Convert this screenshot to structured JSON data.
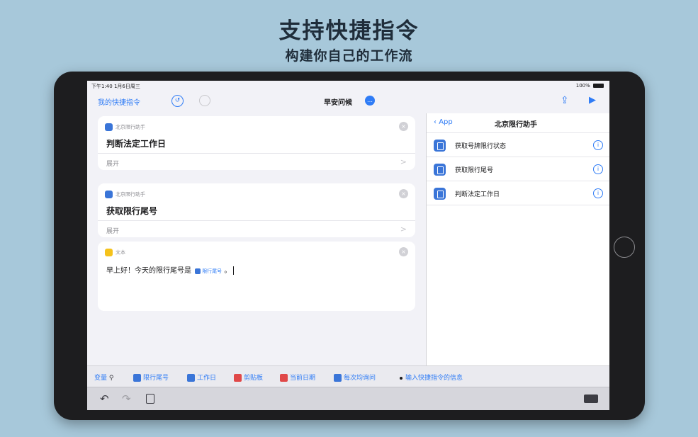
{
  "hero": {
    "title": "支持快捷指令",
    "subtitle": "构建你自己的工作流"
  },
  "status_bar": {
    "time": "下午1:40  1月6日周三",
    "battery": "100%"
  },
  "nav_bar": {
    "back_label": "我的快捷指令",
    "title": "早安问候",
    "title_badge": "…",
    "share_icon": "share-icon",
    "run_icon": "play-icon"
  },
  "editor": {
    "cards": [
      {
        "app": "北京限行助手",
        "title": "判断法定工作日",
        "expand": "展开",
        "chevron": ">"
      },
      {
        "app": "北京限行助手",
        "title": "获取限行尾号",
        "expand": "展开",
        "chevron": ">"
      },
      {
        "app": "文本",
        "text": "早上好！今天的限行尾号是",
        "token": "限行尾号",
        "trailing": "。"
      }
    ]
  },
  "sidebar": {
    "back_label": "App",
    "title": "北京限行助手",
    "items": [
      {
        "label": "获取号牌限行状态"
      },
      {
        "label": "获取限行尾号"
      },
      {
        "label": "判断法定工作日"
      }
    ]
  },
  "variable_bar": {
    "items": [
      {
        "label": "变量",
        "color": "#2f7cf6"
      },
      {
        "label": "限行尾号",
        "color": "#3a75d8"
      },
      {
        "label": "工作日",
        "color": "#3a75d8"
      },
      {
        "label": "剪贴板",
        "color": "#e04848"
      },
      {
        "label": "当前日期",
        "color": "#e04848"
      },
      {
        "label": "每次均询问",
        "color": "#3a75d8"
      },
      {
        "label": "输入快捷指令的信息",
        "color": "#1c1c1e"
      }
    ]
  },
  "keyboard_bar": {
    "undo_icon": "undo-icon",
    "redo_icon": "redo-icon",
    "paste_icon": "paste-icon",
    "dismiss_icon": "keyboard-dismiss-icon"
  }
}
